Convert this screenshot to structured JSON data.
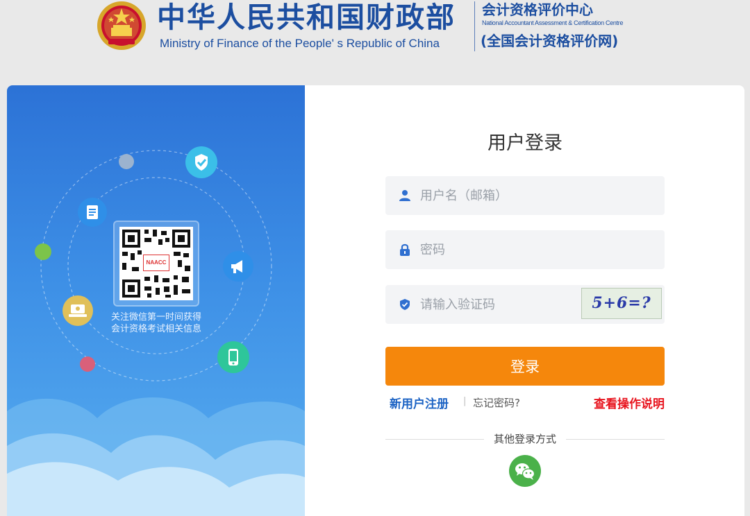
{
  "header": {
    "title_cn": "中华人民共和国财政部",
    "title_en": "Ministry of Finance of the People' s Republic of China",
    "centre_cn": "会计资格评价中心",
    "centre_en": "National Accountant Assessment & Certification Centre",
    "centre_net": "(全国会计资格评价网)"
  },
  "promo": {
    "qr_logo_text": "NAACC",
    "caption_line1": "关注微信第一时间获得",
    "caption_line2": "会计资格考试相关信息"
  },
  "login": {
    "title": "用户登录",
    "username_placeholder": "用户名（邮箱）",
    "password_placeholder": "密码",
    "captcha_placeholder": "请输入验证码",
    "captcha_text": "5+6=?",
    "submit_label": "登录",
    "register_label": "新用户注册",
    "separator": "|",
    "forgot_label": "忘记密码?",
    "help_label": "查看操作说明",
    "other_login_label": "其他登录方式"
  },
  "colors": {
    "brand_blue": "#1c4ea0",
    "accent_orange": "#f5870c",
    "link_blue": "#1c63c4",
    "link_red": "#e8141e",
    "wechat_green": "#4bb14a"
  },
  "icons": {
    "username": "user-icon",
    "password": "lock-icon",
    "captcha": "shield-check-icon",
    "other_login": "wechat-icon"
  }
}
